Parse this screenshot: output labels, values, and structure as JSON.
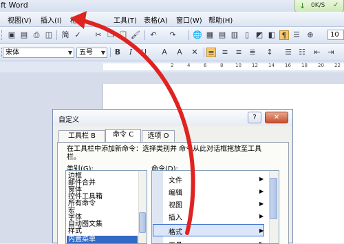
{
  "app": {
    "title": "ft Word"
  },
  "network": {
    "speed": "0K/S",
    "arrow_icon": "down-arrow-icon"
  },
  "menu": [
    "视图(V)",
    "插入(I)",
    "格",
    "工具(T)",
    "表格(A)",
    "窗口(W)",
    "帮助(H)"
  ],
  "toolbar": {
    "font": "宋体",
    "size": "五号",
    "bold": "B",
    "italic": "I",
    "underline": "U",
    "font_color": "A",
    "zoom_partial": "10"
  },
  "ruler": {
    "marks": [
      "2",
      "4",
      "6",
      "8",
      "10",
      "12",
      "14",
      "16",
      "18",
      "20",
      "22"
    ]
  },
  "dialog": {
    "title": "自定义",
    "help_btn": "?",
    "close_btn": "✕",
    "tabs": [
      "工具栏 B",
      "命令 C",
      "选项 O"
    ],
    "hint_line1": "在工具栏中添加新命令：选择类别并   命令从此对话框拖放至工具",
    "hint_line2": "栏。",
    "category_label": "类别(G):",
    "command_label": "命令(D):",
    "categories": [
      "边框",
      "邮件合并",
      "窗体",
      "控件工具箱",
      "所有命令",
      "宏",
      "字体",
      "自动图文集",
      "样式",
      "内置菜单"
    ],
    "selected_category": "内置菜单",
    "commands": [
      "文件",
      "编辑",
      "视图",
      "插入",
      "格式",
      "工具"
    ],
    "selected_command": "格式"
  },
  "colors": {
    "arrow": "#e0231f",
    "selection": "#316ac5",
    "title_bar": "#d6dff0"
  }
}
